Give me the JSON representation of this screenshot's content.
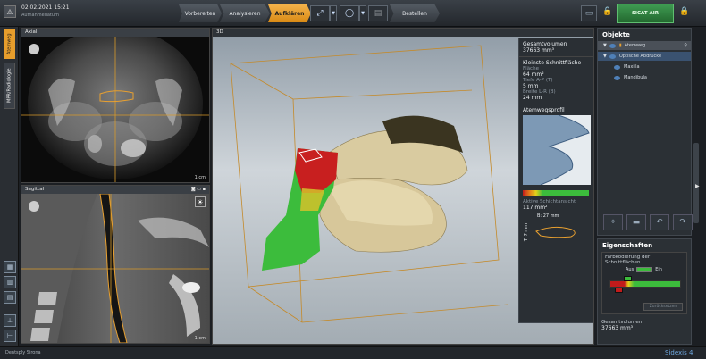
{
  "header": {
    "datetime": "02.02.2021 15:21",
    "subtitle": "Aufnahmedatum",
    "steps": [
      {
        "label": "Vorbereiten"
      },
      {
        "label": "Analysieren"
      },
      {
        "label": "Aufklären"
      },
      {
        "label": "Bestellen"
      }
    ],
    "active_step": "Aufklären",
    "sicat_label": "SICAT AIR"
  },
  "left_tabs": {
    "tab1": "Atemweg",
    "tab2": "MPR/Radiologie"
  },
  "views": {
    "axial": {
      "title": "Axial",
      "scale": "1 cm"
    },
    "sagittal": {
      "title": "Sagittal",
      "scale": "1 cm"
    },
    "view3d": {
      "title": "3D"
    }
  },
  "airway_info": {
    "total_volume_label": "Gesamtvolumen",
    "total_volume_value": "37663 mm³",
    "min_cross_label": "Kleinste Schnittfläche",
    "area_label": "Fläche",
    "area_value": "64 mm²",
    "depth_label": "Tiefe A-P (T)",
    "depth_value": "5 mm",
    "width_label": "Breite L-R (B)",
    "width_value": "24 mm",
    "profile_label": "Atemwegsprofil",
    "active_slice_label": "Aktive Schichtansicht",
    "active_slice_value": "117 mm²",
    "b_value": "B: 27 mm",
    "t_value": "T: 7 mm"
  },
  "objects": {
    "title": "Objekte",
    "items": [
      {
        "label": "Atemweg"
      },
      {
        "label": "Optische Abdrücke"
      },
      {
        "label": "Maxilla"
      },
      {
        "label": "Mandibula"
      }
    ]
  },
  "properties": {
    "title": "Eigenschaften",
    "color_coding_label": "Farbkodierung der Schnittflächen",
    "off_label": "Aus",
    "on_label": "Ein",
    "reset_label": "Zurücksetzen",
    "total_volume_label": "Gesamtvolumen",
    "total_volume_value": "37663 mm³"
  },
  "footer": {
    "brand": "Dentsply Sirona",
    "product": "Sidexis 4"
  },
  "colors": {
    "accent": "#e8a030",
    "airway_green": "#3cbc3c",
    "airway_red": "#cc2222"
  }
}
